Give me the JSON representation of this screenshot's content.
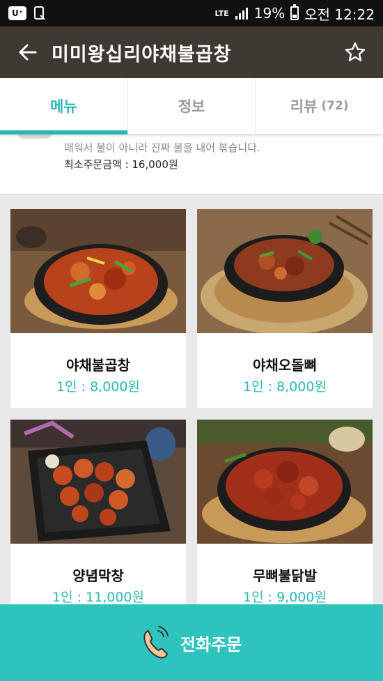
{
  "status_bar": {
    "app_badge": "U⁺",
    "network": "LTE",
    "battery": "19%",
    "time": "오전 12:22"
  },
  "header": {
    "title": "미미왕십리야채불곱창"
  },
  "tabs": [
    {
      "label": "메뉴",
      "active": true
    },
    {
      "label": "정보",
      "active": false
    },
    {
      "label": "리뷰",
      "count": "(72)",
      "active": false
    }
  ],
  "info": {
    "cut_text": "...",
    "description": "매워서 불이 아니라 진짜 불을 내어 볶습니다.",
    "min_order": "최소주문금액 : 16,000원"
  },
  "menu_items": [
    {
      "name": "야채불곱창",
      "price": "1인 : 8,000원"
    },
    {
      "name": "야채오돌뼈",
      "price": "1인 : 8,000원"
    },
    {
      "name": "양념막창",
      "price": "1인 : 11,000원"
    },
    {
      "name": "무뼈불닭발",
      "price": "1인 : 9,000원"
    }
  ],
  "footer": {
    "label": "전화주문"
  },
  "colors": {
    "accent": "#2ab8b3",
    "footer_bg": "#2ec3bd",
    "app_bar": "#3f3933"
  },
  "icons": [
    "back-arrow-icon",
    "star-icon",
    "phone-icon",
    "battery-icon",
    "signal-icon",
    "screenshot-icon"
  ]
}
